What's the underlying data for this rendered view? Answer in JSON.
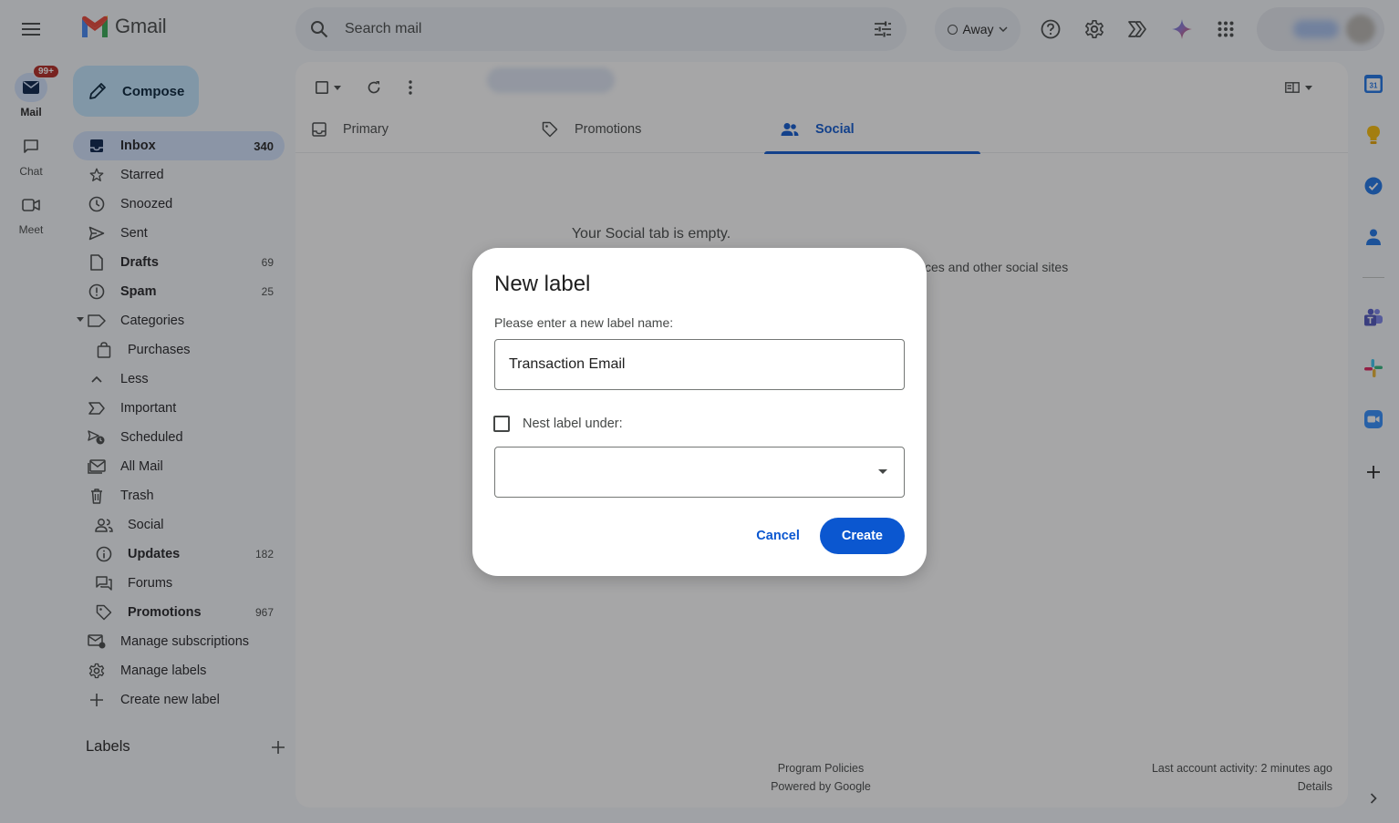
{
  "app": {
    "name": "Gmail",
    "icons": [
      "hamburger-icon",
      "gmail-logo-icon"
    ]
  },
  "rail": {
    "items": [
      {
        "label": "Mail",
        "badge": "99+",
        "active": true,
        "icon": "mail-icon"
      },
      {
        "label": "Chat",
        "icon": "chat-icon"
      },
      {
        "label": "Meet",
        "icon": "meet-icon"
      }
    ]
  },
  "sidebar": {
    "compose_label": "Compose",
    "items": [
      {
        "label": "Inbox",
        "count": "340",
        "icon": "inbox-icon",
        "active": true
      },
      {
        "label": "Starred",
        "count": "",
        "icon": "star-icon"
      },
      {
        "label": "Snoozed",
        "count": "",
        "icon": "clock-icon"
      },
      {
        "label": "Sent",
        "count": "",
        "icon": "send-icon"
      },
      {
        "label": "Drafts",
        "count": "69",
        "icon": "draft-icon",
        "bold": true
      },
      {
        "label": "Spam",
        "count": "25",
        "icon": "spam-icon",
        "bold": true
      },
      {
        "label": "Categories",
        "count": "",
        "icon": "label-icon"
      },
      {
        "label": "Purchases",
        "count": "",
        "icon": "shopping-bag-icon",
        "sub": true
      },
      {
        "label": "Less",
        "count": "",
        "icon": "chevron-up-icon"
      },
      {
        "label": "Important",
        "count": "",
        "icon": "important-icon"
      },
      {
        "label": "Scheduled",
        "count": "",
        "icon": "scheduled-send-icon"
      },
      {
        "label": "All Mail",
        "count": "",
        "icon": "all-mail-icon"
      },
      {
        "label": "Trash",
        "count": "",
        "icon": "trash-icon"
      },
      {
        "label": "Social",
        "count": "",
        "icon": "people-icon",
        "sub": true
      },
      {
        "label": "Updates",
        "count": "182",
        "icon": "info-icon",
        "sub": true,
        "bold": true
      },
      {
        "label": "Forums",
        "count": "",
        "icon": "forum-icon",
        "sub": true
      },
      {
        "label": "Promotions",
        "count": "967",
        "icon": "tag-icon",
        "sub": true,
        "bold": true
      },
      {
        "label": "Manage subscriptions",
        "count": "",
        "icon": "manage-subscriptions-icon"
      },
      {
        "label": "Manage labels",
        "count": "",
        "icon": "gear-icon"
      },
      {
        "label": "Create new label",
        "count": "",
        "icon": "plus-icon"
      }
    ],
    "labels_heading": "Labels"
  },
  "topbar": {
    "search_placeholder": "Search mail",
    "status_label": "Away",
    "icons": [
      "search-icon",
      "filter-options-icon",
      "help-icon",
      "settings-icon",
      "gemini-icon",
      "apps-grid-icon"
    ]
  },
  "toolbar": {
    "icons": [
      "checkbox-icon",
      "refresh-icon",
      "more-vert-icon",
      "split-pane-icon"
    ]
  },
  "tabs": [
    {
      "label": "Primary",
      "icon": "inbox-icon",
      "active": false
    },
    {
      "label": "Promotions",
      "icon": "tag-icon",
      "active": false
    },
    {
      "label": "Social",
      "icon": "people-icon",
      "active": true
    }
  ],
  "content": {
    "empty_title": "Your Social tab is empty.",
    "empty_subtitle_fragment": "ces and other social sites"
  },
  "footer": {
    "program_policies": "Program Policies",
    "powered_by": "Powered by Google",
    "last_activity": "Last account activity: 2 minutes ago",
    "details": "Details"
  },
  "side_panel": {
    "icons": [
      "calendar-icon",
      "keep-icon",
      "tasks-icon",
      "contacts-icon",
      "teams-icon",
      "slack-icon",
      "zoom-icon",
      "add-icon",
      "expand-icon"
    ],
    "calendar_day": "31"
  },
  "dialog": {
    "title": "New label",
    "prompt": "Please enter a new label name:",
    "input_value": "Transaction Email",
    "nest_label": "Nest label under:",
    "nest_checked": false,
    "select_value": "",
    "cancel_label": "Cancel",
    "create_label": "Create"
  },
  "colors": {
    "background": "#f6f8fc",
    "accent": "#0b57d0",
    "active_nav": "#d3e3fd",
    "compose": "#c2e7ff",
    "badge": "#b3261e"
  }
}
